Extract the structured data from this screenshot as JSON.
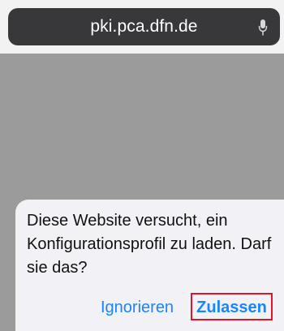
{
  "browser": {
    "url": "pki.pca.dfn.de",
    "mic_icon": "microphone-icon"
  },
  "alert": {
    "message": "Diese Website versucht, ein Konfigurationsprofil zu laden. Darf sie das?",
    "ignore_label": "Ignorieren",
    "allow_label": "Zulassen"
  },
  "colors": {
    "address_bar": "#38383a",
    "accent": "#1a84ff",
    "highlight": "#e0152a",
    "backdrop": "#9b9b9b",
    "alert_background": "#f2f2f6"
  }
}
